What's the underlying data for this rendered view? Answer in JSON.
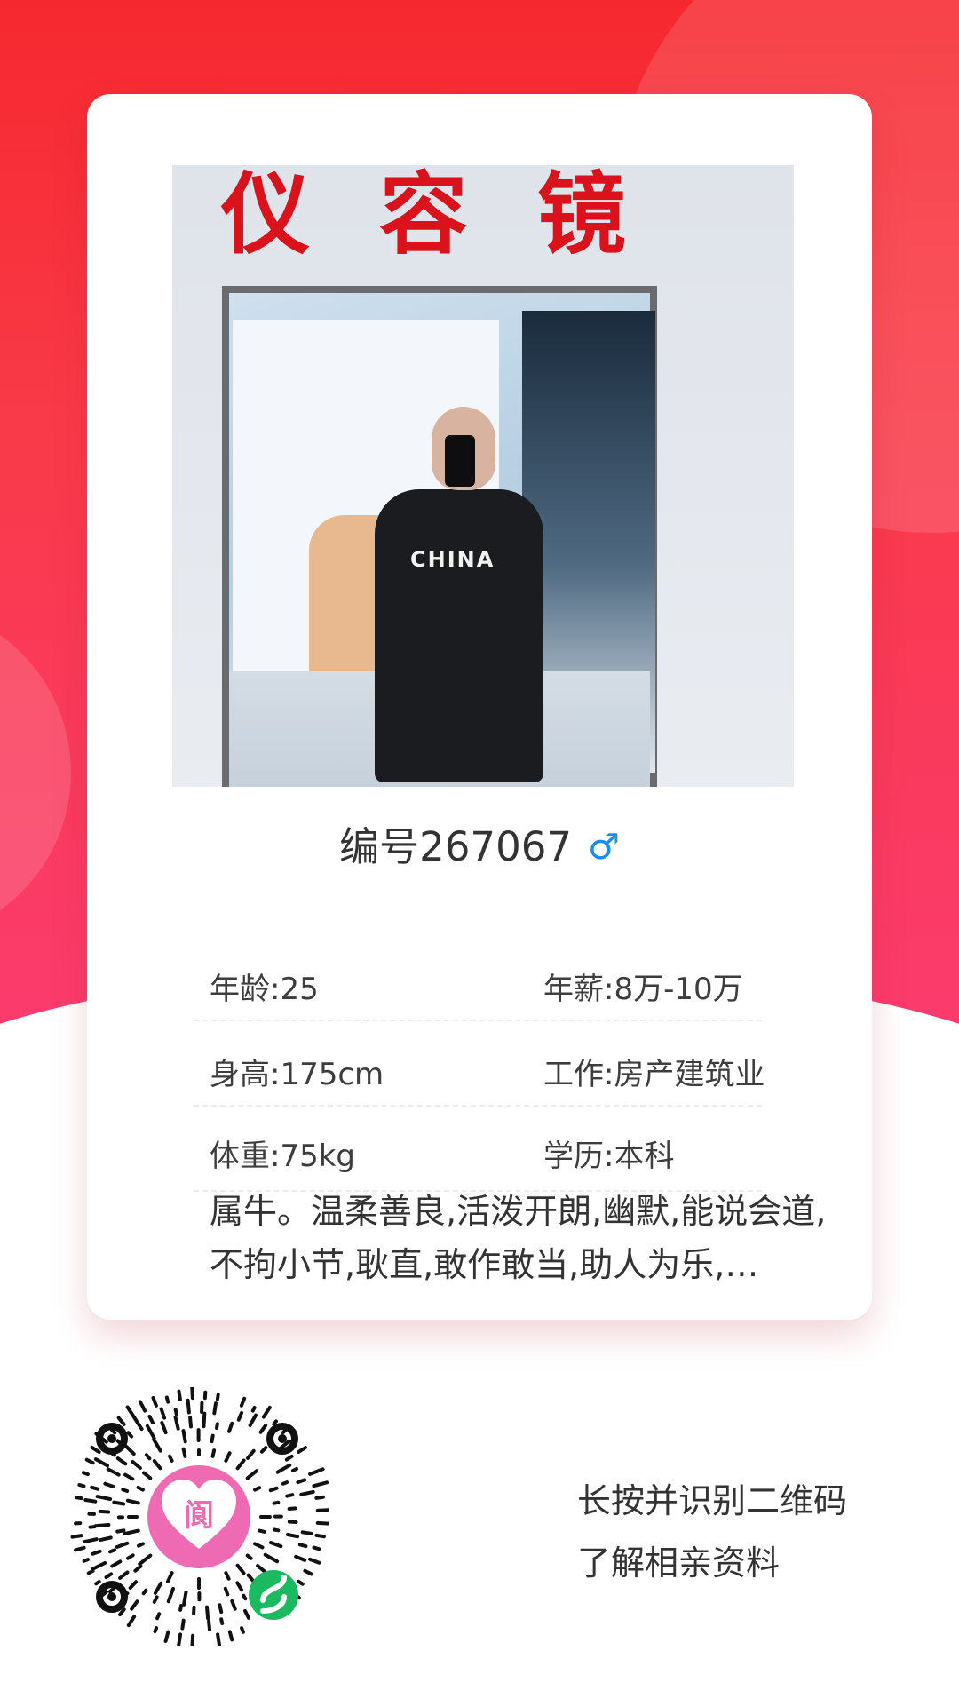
{
  "profile": {
    "id_label": "编号267067",
    "gender_symbol": "♂",
    "photo": {
      "sign_text": "仪容镜",
      "shirt_text": "CHINA"
    },
    "info": [
      {
        "left": "年龄:25",
        "right": "年薪:8万-10万"
      },
      {
        "left": "身高:175cm",
        "right": "工作:房产建筑业"
      },
      {
        "left": "体重:75kg",
        "right": "学历:本科"
      }
    ],
    "description": "属牛。温柔善良,活泼开朗,幽默,能说会道,不拘小节,耿直,敢作敢当,助人为乐,…"
  },
  "qr": {
    "line1": "长按并识别二维码",
    "line2": "了解相亲资料",
    "center_badge_char": "阆"
  },
  "colors": {
    "bg_top": "#f6282f",
    "bg_bottom": "#fb3b6e",
    "gender": "#1b8df0",
    "qr_center": "#ee6ab3",
    "mini_program_badge": "#1bb960"
  }
}
